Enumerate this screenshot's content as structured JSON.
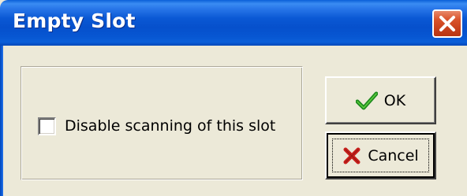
{
  "window": {
    "title": "Empty Slot",
    "close_icon": "close-icon"
  },
  "options": {
    "disable_scanning_label": "Disable scanning of this slot",
    "disable_scanning_checked": false
  },
  "buttons": {
    "ok_label": "OK",
    "ok_icon": "checkmark-icon",
    "cancel_label": "Cancel",
    "cancel_icon": "x-mark-icon"
  },
  "colors": {
    "titlebar": "#0a58d4",
    "dialog_bg": "#ece9d8",
    "close_button": "#d9522a",
    "ok_icon": "#1e8a1e",
    "cancel_icon": "#c8201c"
  }
}
